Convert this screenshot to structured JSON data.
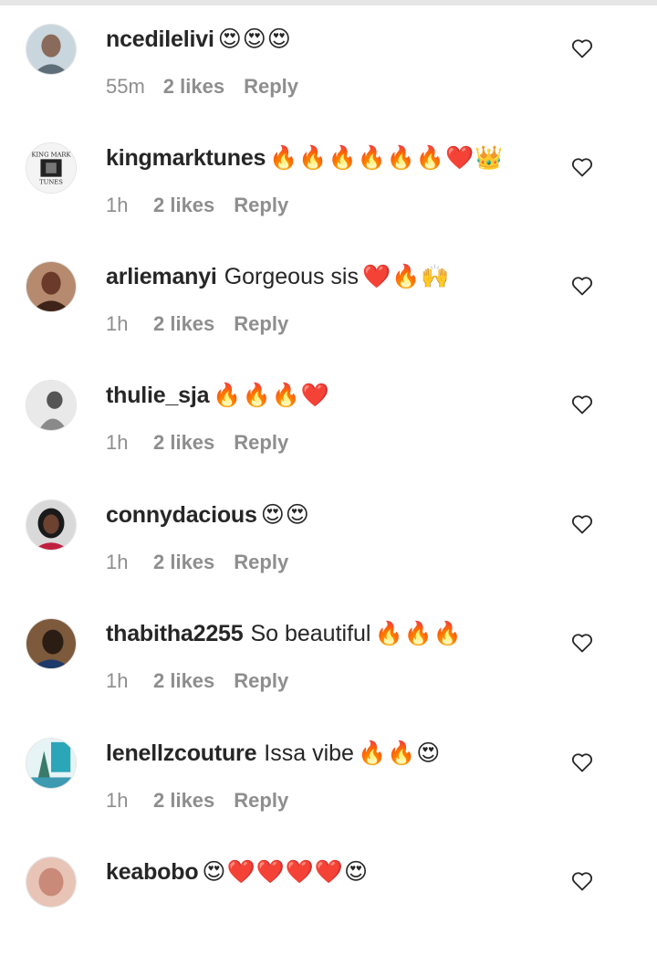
{
  "comments": [
    {
      "username": "ncedilelivi",
      "text": "",
      "emoji": "😍😍😍",
      "time": "55m",
      "likes": "2 likes",
      "reply": "Reply",
      "avatar_color": "#9a9a9a",
      "avatar_bg": "#c9d6dd"
    },
    {
      "username": "kingmarktunes",
      "text": "",
      "emoji": "🔥🔥🔥🔥🔥🔥❤️👑",
      "time": "1h",
      "likes": "2 likes",
      "reply": "Reply",
      "avatar_color": "#222222",
      "avatar_bg": "#f4f4f4"
    },
    {
      "username": "arliemanyi",
      "text": "Gorgeous sis",
      "emoji": "❤️🔥🙌",
      "time": "1h",
      "likes": "2 likes",
      "reply": "Reply",
      "avatar_color": "#6b3a2a",
      "avatar_bg": "#b58a6e"
    },
    {
      "username": "thulie_sja",
      "text": "",
      "emoji": "🔥🔥🔥❤️",
      "time": "1h",
      "likes": "2 likes",
      "reply": "Reply",
      "avatar_color": "#555555",
      "avatar_bg": "#e9e9e9"
    },
    {
      "username": "connydacious",
      "text": "",
      "emoji": "😍😍",
      "time": "1h",
      "likes": "2 likes",
      "reply": "Reply",
      "avatar_color": "#1a1a1a",
      "avatar_bg": "#d9d9d9"
    },
    {
      "username": "thabitha2255",
      "text": "So beautiful",
      "emoji": "🔥🔥🔥",
      "time": "1h",
      "likes": "2 likes",
      "reply": "Reply",
      "avatar_color": "#2b1d14",
      "avatar_bg": "#7d5a3c"
    },
    {
      "username": "lenellzcouture",
      "text": "Issa vibe",
      "emoji": "🔥🔥😍",
      "time": "1h",
      "likes": "2 likes",
      "reply": "Reply",
      "avatar_color": "#2aa6b8",
      "avatar_bg": "#e6f4f6"
    },
    {
      "username": "keabobo",
      "text": "",
      "emoji": "😍❤️❤️❤️❤️😍",
      "time": "",
      "likes": "",
      "reply": "",
      "avatar_color": "#c98a7a",
      "avatar_bg": "#e8c4b6"
    }
  ]
}
